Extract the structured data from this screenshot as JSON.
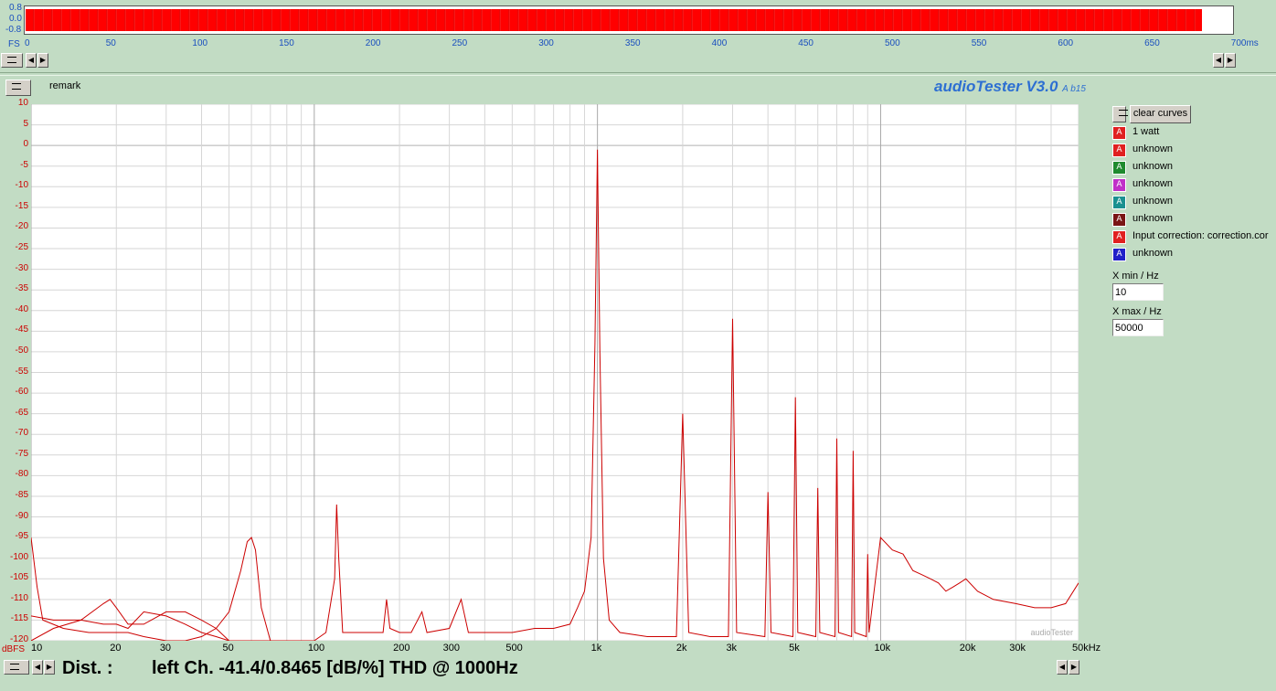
{
  "waveform": {
    "y_labels": [
      "0.8",
      "0.0",
      "-0.8"
    ],
    "fs_label": "FS",
    "time_ticks": [
      "0",
      "50",
      "100",
      "150",
      "200",
      "250",
      "300",
      "350",
      "400",
      "450",
      "500",
      "550",
      "600",
      "650",
      "700ms"
    ],
    "fill_fraction": 0.975,
    "color": "#ff0000"
  },
  "remark_label": "remark",
  "app_title": "audioTester V3.0",
  "app_version": "A b15",
  "watermark": "audioTester",
  "spectrum": {
    "ylabel": "dBFS",
    "y_ticks": [
      "10",
      "5",
      "0",
      "-5",
      "-10",
      "-15",
      "-20",
      "-25",
      "-30",
      "-35",
      "-40",
      "-45",
      "-50",
      "-55",
      "-60",
      "-65",
      "-70",
      "-75",
      "-80",
      "-85",
      "-90",
      "-95",
      "-100",
      "-105",
      "-110",
      "-115",
      "-120"
    ],
    "x_ticks": [
      "10",
      "20",
      "30",
      "50",
      "100",
      "200",
      "300",
      "500",
      "1k",
      "2k",
      "3k",
      "5k",
      "10k",
      "20k",
      "30k",
      "50kHz"
    ],
    "xlim": [
      10,
      50000
    ],
    "ylim": [
      -120,
      10
    ],
    "grid": true,
    "line_color": "#cc0000"
  },
  "chart_data": {
    "type": "line",
    "xlabel": "",
    "ylabel": "dBFS",
    "xscale": "log",
    "xlim": [
      10,
      50000
    ],
    "ylim": [
      -120,
      10
    ],
    "grid": true,
    "series": [
      {
        "name": "1 watt",
        "x": [
          10,
          10.5,
          11,
          13,
          16,
          18,
          20,
          22,
          25,
          30,
          35,
          40,
          45,
          50,
          55,
          58,
          60,
          62,
          65,
          70,
          80,
          100,
          110,
          118,
          120,
          122,
          126,
          135,
          150,
          160,
          175,
          180,
          185,
          200,
          220,
          240,
          250,
          300,
          330,
          350,
          360,
          400,
          500,
          600,
          700,
          800,
          850,
          900,
          950,
          980,
          1000,
          1020,
          1050,
          1100,
          1200,
          1500,
          1900,
          2000,
          2100,
          2500,
          2900,
          3000,
          3100,
          3900,
          4000,
          4100,
          4900,
          5000,
          5100,
          5900,
          6000,
          6100,
          6900,
          7000,
          7100,
          7900,
          8000,
          8100,
          8900,
          9000,
          9100,
          10000,
          11000,
          12000,
          13000,
          14000,
          15000,
          16000,
          17000,
          18000,
          19000,
          20000,
          22000,
          25000,
          30000,
          35000,
          40000,
          45000,
          50000
        ],
        "y": [
          -95,
          -107,
          -115,
          -117,
          -118,
          -118,
          -118,
          -118,
          -119,
          -120,
          -120,
          -119,
          -117,
          -113,
          -103,
          -96,
          -95,
          -98,
          -112,
          -120,
          -120,
          -120,
          -118,
          -105,
          -87,
          -100,
          -118,
          -118,
          -118,
          -118,
          -118,
          -110,
          -117,
          -118,
          -118,
          -113,
          -118,
          -117,
          -110,
          -118,
          -118,
          -118,
          -118,
          -117,
          -117,
          -116,
          -112,
          -108,
          -95,
          -48,
          -1,
          -50,
          -100,
          -115,
          -118,
          -119,
          -119,
          -65,
          -118,
          -119,
          -119,
          -42,
          -118,
          -119,
          -84,
          -118,
          -119,
          -61,
          -118,
          -119,
          -83,
          -118,
          -119,
          -71,
          -118,
          -119,
          -74,
          -118,
          -119,
          -99,
          -118,
          -95,
          -98,
          -99,
          -103,
          -104,
          -105,
          -106,
          -108,
          -107,
          -106,
          -105,
          -108,
          -110,
          -111,
          -112,
          -112,
          -111,
          -106
        ]
      },
      {
        "name": "unknown",
        "x": [
          10,
          12,
          15,
          18,
          20,
          22,
          25,
          30,
          35,
          40,
          45,
          50,
          60,
          100
        ],
        "y": [
          -114,
          -115,
          -115,
          -116,
          -116,
          -117,
          -113,
          -114,
          -116,
          -118,
          -119,
          -120,
          -120,
          -120
        ]
      },
      {
        "name": "unknown",
        "x": [
          10,
          12,
          15,
          18,
          19,
          20,
          22,
          25,
          30,
          35,
          40,
          45,
          50
        ],
        "y": [
          -120,
          -117,
          -115,
          -111,
          -110,
          -112,
          -116,
          -116,
          -113,
          -113,
          -115,
          -117,
          -120
        ]
      }
    ]
  },
  "legend": {
    "clear_button": "clear curves",
    "items": [
      {
        "label": "1 watt",
        "color": "#e02020",
        "icon": "curve-a-icon"
      },
      {
        "label": "unknown",
        "color": "#e02020",
        "icon": "curve-a-icon"
      },
      {
        "label": "unknown",
        "color": "#1f8a2e",
        "icon": "curve-a-icon"
      },
      {
        "label": "unknown",
        "color": "#c030c8",
        "icon": "curve-a-icon"
      },
      {
        "label": "unknown",
        "color": "#1a9090",
        "icon": "curve-a-icon"
      },
      {
        "label": "unknown",
        "color": "#7a1515",
        "icon": "curve-a-icon"
      },
      {
        "label": "Input correction: correction.cor",
        "color": "#e02020",
        "icon": "curve-a-icon"
      },
      {
        "label": "unknown",
        "color": "#2020c8",
        "icon": "curve-a-icon"
      }
    ],
    "icon_glyph": "A"
  },
  "xmin": {
    "label": "X min / Hz",
    "value": "10"
  },
  "xmax": {
    "label": "X max / Hz",
    "value": "50000"
  },
  "status": {
    "dist_label": "Dist. :",
    "dist_text": "left Ch. -41.4/0.8465 [dB/%] THD @ 1000Hz"
  }
}
